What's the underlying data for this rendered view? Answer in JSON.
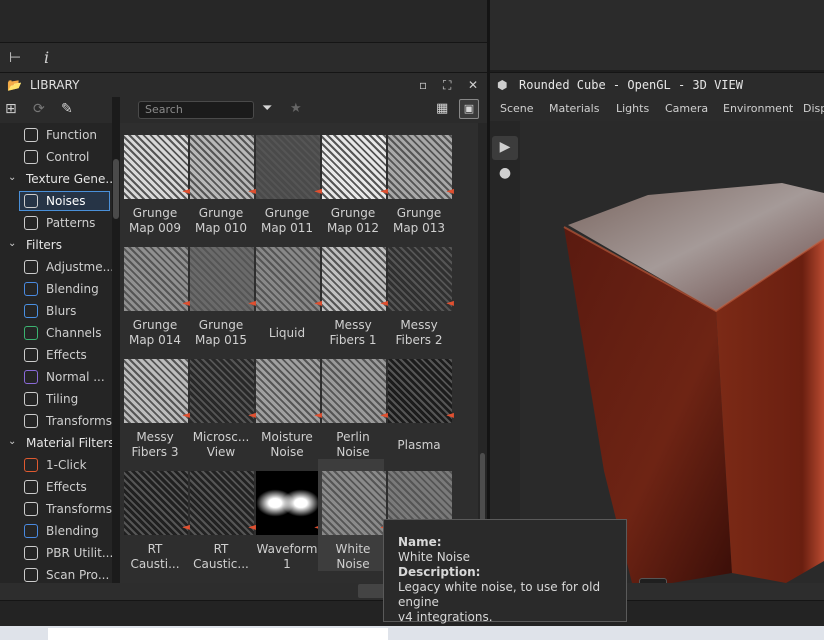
{
  "toolbar": {
    "tree_icon": "tree-icon",
    "info_icon": "info-icon"
  },
  "library": {
    "title": "LIBRARY",
    "search_placeholder": "Search",
    "sidebar": [
      {
        "label": "Function",
        "type": "item",
        "color": "#cccccc"
      },
      {
        "label": "Control",
        "type": "item",
        "color": "#cccccc"
      },
      {
        "label": "Texture Gene...",
        "type": "category"
      },
      {
        "label": "Noises",
        "type": "item",
        "selected": true,
        "color": "#cccccc"
      },
      {
        "label": "Patterns",
        "type": "item",
        "color": "#cccccc"
      },
      {
        "label": "Filters",
        "type": "category"
      },
      {
        "label": "Adjustme...",
        "type": "item",
        "color": "#cccccc"
      },
      {
        "label": "Blending",
        "type": "item",
        "color": "#4a8ae0"
      },
      {
        "label": "Blurs",
        "type": "item",
        "color": "#4a90e2"
      },
      {
        "label": "Channels",
        "type": "item",
        "color": "#3cb371"
      },
      {
        "label": "Effects",
        "type": "item",
        "color": "#cccccc"
      },
      {
        "label": "Normal ...",
        "type": "item",
        "color": "#8a6ad8"
      },
      {
        "label": "Tiling",
        "type": "item",
        "color": "#cccccc"
      },
      {
        "label": "Transforms",
        "type": "item",
        "color": "#cccccc"
      },
      {
        "label": "Material Filters",
        "type": "category"
      },
      {
        "label": "1-Click",
        "type": "item",
        "color": "#e05a30"
      },
      {
        "label": "Effects",
        "type": "item",
        "color": "#cccccc"
      },
      {
        "label": "Transforms",
        "type": "item",
        "color": "#cccccc"
      },
      {
        "label": "Blending",
        "type": "item",
        "color": "#4a8ae0"
      },
      {
        "label": "PBR Utilit...",
        "type": "item",
        "color": "#cccccc"
      },
      {
        "label": "Scan Pro...",
        "type": "item",
        "color": "#cccccc"
      }
    ],
    "tiles": [
      {
        "line1": "Grunge",
        "line2": "Map 009"
      },
      {
        "line1": "Grunge",
        "line2": "Map 010"
      },
      {
        "line1": "Grunge",
        "line2": "Map 011"
      },
      {
        "line1": "Grunge",
        "line2": "Map 012"
      },
      {
        "line1": "Grunge",
        "line2": "Map 013"
      },
      {
        "line1": "Grunge",
        "line2": "Map 014"
      },
      {
        "line1": "Grunge",
        "line2": "Map 015"
      },
      {
        "line1": "Liquid",
        "line2": ""
      },
      {
        "line1": "Messy",
        "line2": "Fibers 1"
      },
      {
        "line1": "Messy",
        "line2": "Fibers 2"
      },
      {
        "line1": "Messy",
        "line2": "Fibers 3"
      },
      {
        "line1": "Microsc...",
        "line2": "View"
      },
      {
        "line1": "Moisture",
        "line2": "Noise"
      },
      {
        "line1": "Perlin",
        "line2": "Noise"
      },
      {
        "line1": "Plasma",
        "line2": ""
      },
      {
        "line1": "RT",
        "line2": "Causti..."
      },
      {
        "line1": "RT",
        "line2": "Caustic..."
      },
      {
        "line1": "Waveform",
        "line2": "1"
      },
      {
        "line1": "White",
        "line2": "Noise"
      },
      {
        "line1": "",
        "line2": ""
      }
    ]
  },
  "view3d": {
    "title": "Rounded Cube - OpenGL - 3D VIEW",
    "menu": [
      "Scene",
      "Materials",
      "Lights",
      "Camera",
      "Environment",
      "Disp"
    ]
  },
  "tooltip": {
    "name_label": "Name:",
    "name_value": "White Noise",
    "desc_label": "Description:",
    "desc_value_1": "Legacy white noise, to use for old engine",
    "desc_value_2": "v4 integrations."
  }
}
